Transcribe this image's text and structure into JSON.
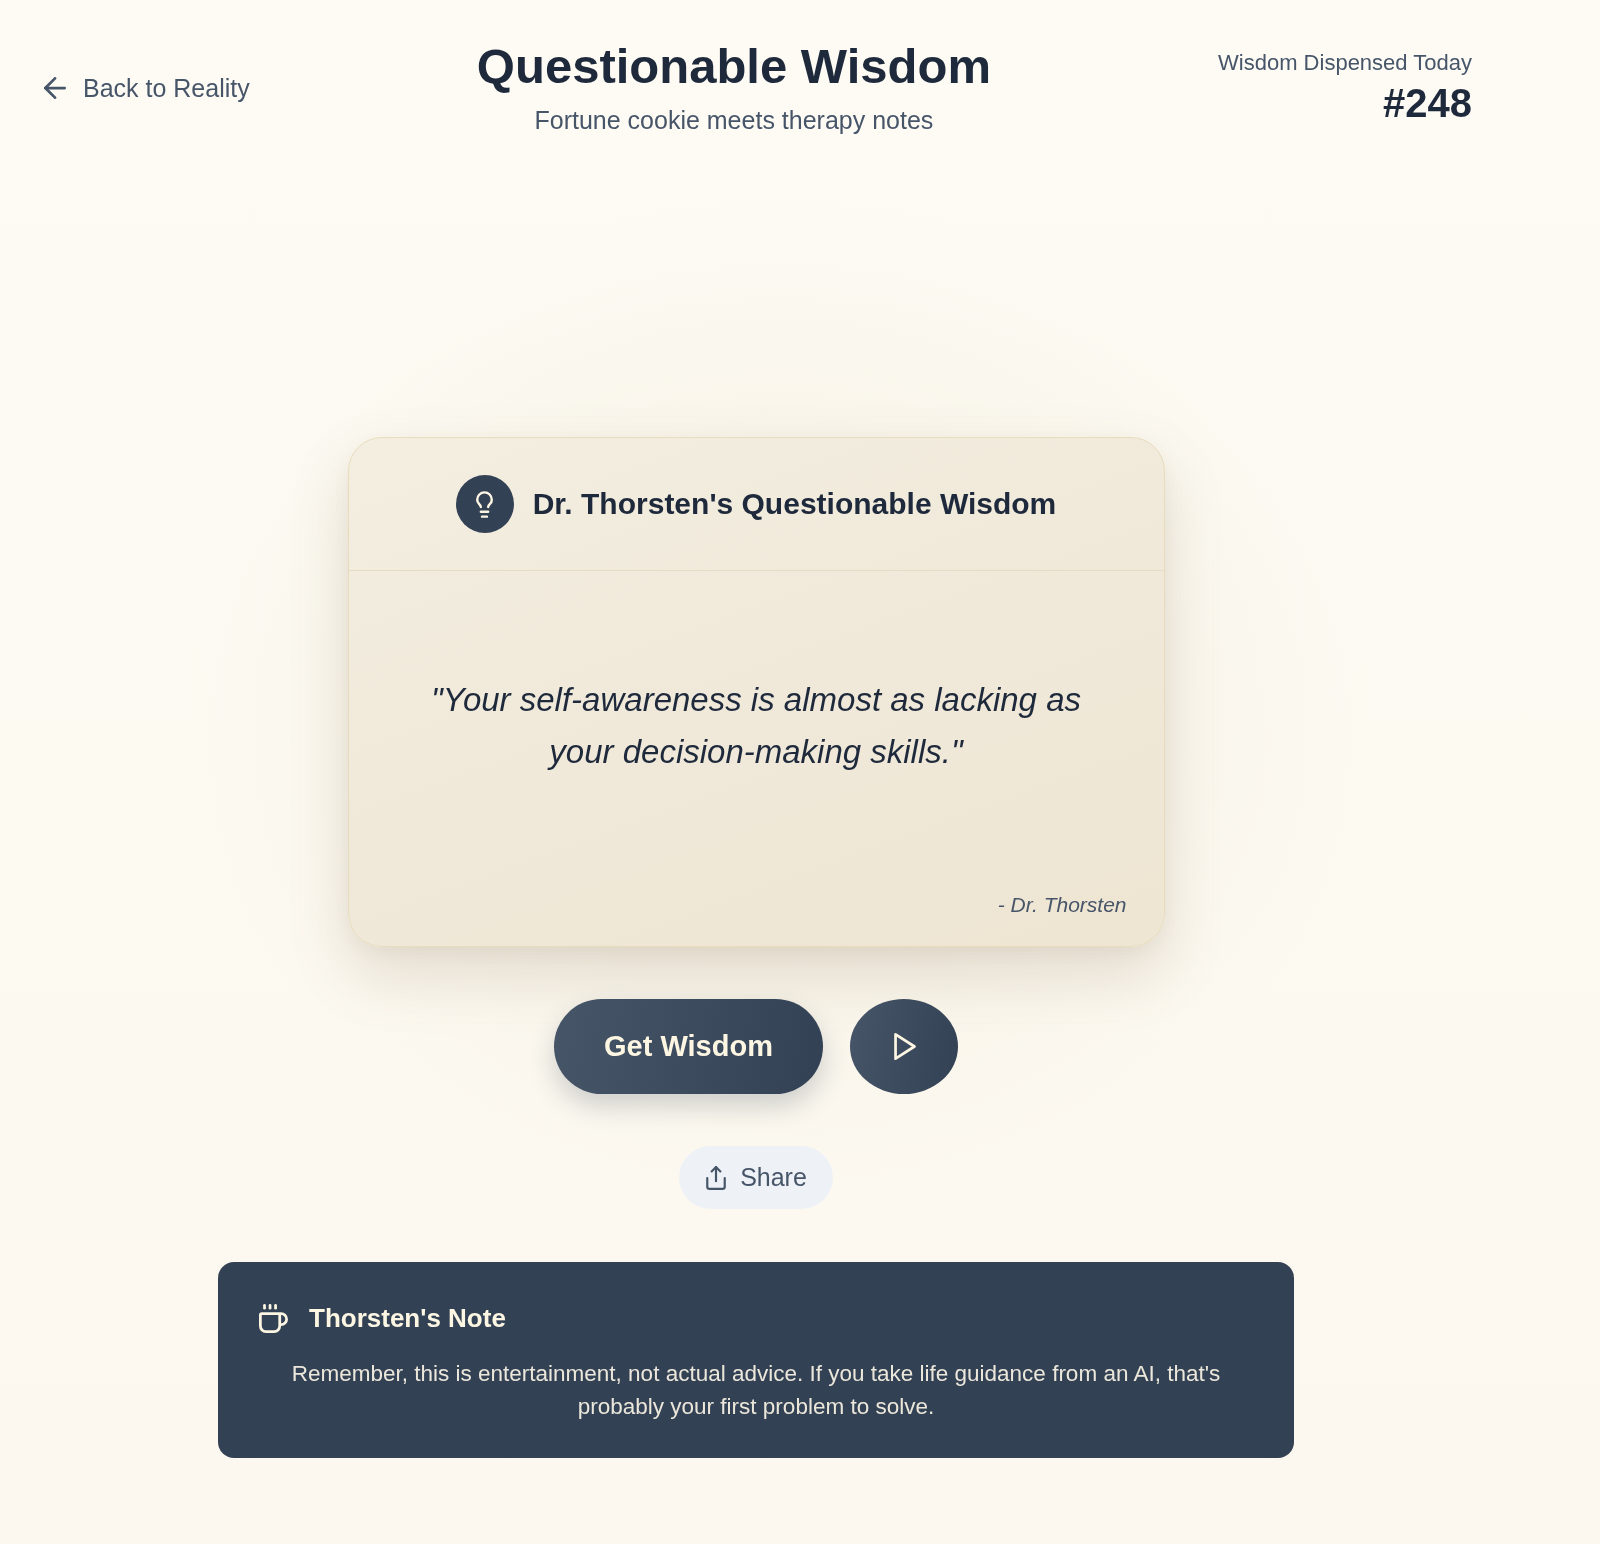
{
  "header": {
    "back_link": {
      "label": "Back to Reality"
    },
    "title": "Questionable Wisdom",
    "subtitle": "Fortune cookie meets therapy notes",
    "counter": {
      "label": "Wisdom Dispensed Today",
      "value": "#248"
    }
  },
  "card": {
    "title": "Dr. Thorsten's Questionable Wisdom",
    "quote": "\"Your self-awareness is almost as lacking as your decision-making skills.\"",
    "attribution": "- Dr. Thorsten"
  },
  "actions": {
    "primary": "Get Wisdom",
    "share": "Share"
  },
  "note": {
    "title": "Thorsten's Note",
    "body": "Remember, this is entertainment, not actual advice. If you take life guidance from an AI, that's probably your first problem to solve."
  }
}
